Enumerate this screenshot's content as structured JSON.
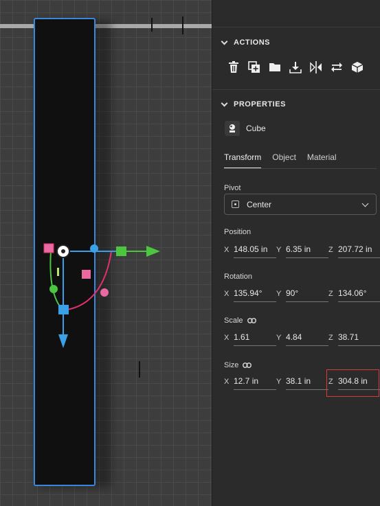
{
  "viewport": {
    "object_color": "#101010",
    "selection_color": "#3a87e0",
    "gizmo_colors": {
      "x": "#4cc640",
      "y": "#3aa0e8",
      "z": "#e0306f"
    }
  },
  "actions": {
    "title": "ACTIONS",
    "items": [
      {
        "name": "delete",
        "icon": "trash-icon"
      },
      {
        "name": "duplicate",
        "icon": "duplicate-icon"
      },
      {
        "name": "group",
        "icon": "folder-icon"
      },
      {
        "name": "drop-to-ground",
        "icon": "drop-to-ground-icon"
      },
      {
        "name": "mirror",
        "icon": "mirror-icon"
      },
      {
        "name": "swap",
        "icon": "swap-icon"
      },
      {
        "name": "convert",
        "icon": "cube-convert-icon"
      }
    ]
  },
  "properties": {
    "title": "PROPERTIES",
    "object_name": "Cube",
    "tabs": [
      "Transform",
      "Object",
      "Material"
    ],
    "active_tab": "Transform",
    "pivot": {
      "label": "Pivot",
      "value": "Center"
    },
    "position": {
      "label": "Position",
      "x": "148.05 in",
      "y": "6.35 in",
      "z": "207.72 in"
    },
    "rotation": {
      "label": "Rotation",
      "x": "135.94°",
      "y": "90°",
      "z": "134.06°"
    },
    "scale": {
      "label": "Scale",
      "x": "1.61",
      "y": "4.84",
      "z": "38.71"
    },
    "size": {
      "label": "Size",
      "x": "12.7 in",
      "y": "38.1 in",
      "z": "304.8 in"
    },
    "axis_labels": {
      "x": "X",
      "y": "Y",
      "z": "Z"
    }
  },
  "colors": {
    "highlight": "#d93a3a",
    "panel_bg": "#2b2b2b"
  }
}
